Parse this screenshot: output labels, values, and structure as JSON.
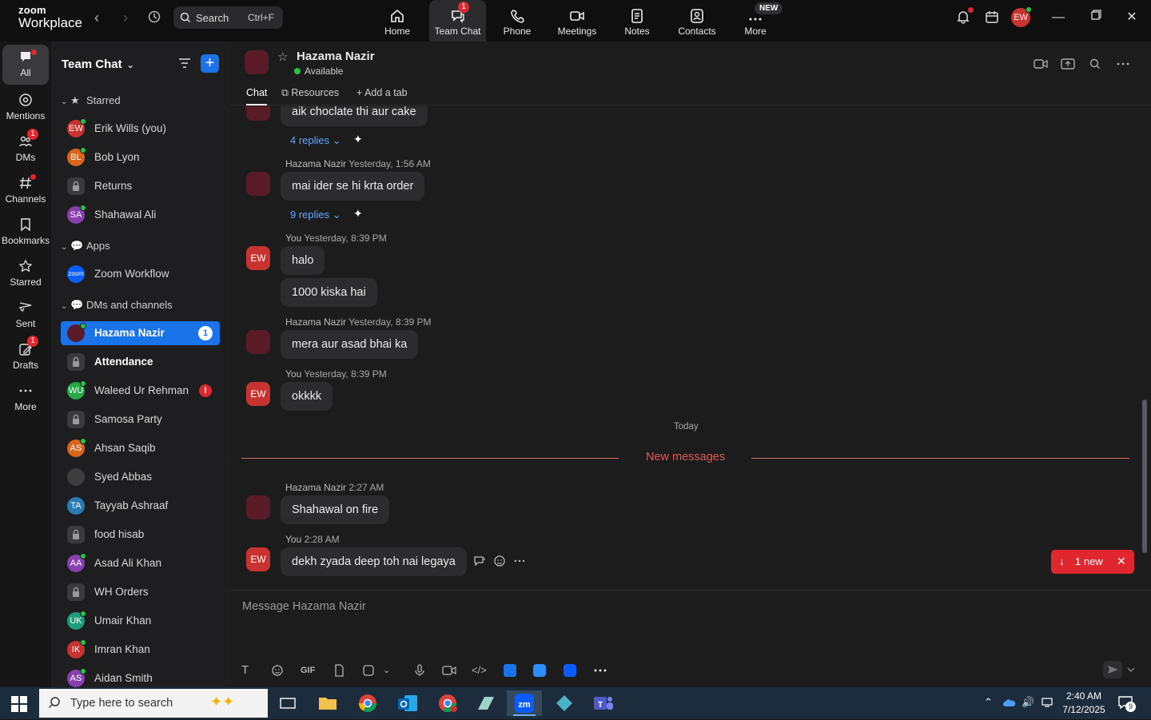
{
  "topbar": {
    "logo_line1": "zoom",
    "logo_line2": "Workplace",
    "search_label": "Search",
    "search_shortcut": "Ctrl+F",
    "nav": [
      {
        "label": "Home"
      },
      {
        "label": "Team Chat",
        "badge": "1"
      },
      {
        "label": "Phone"
      },
      {
        "label": "Meetings"
      },
      {
        "label": "Notes"
      },
      {
        "label": "Contacts"
      },
      {
        "label": "More",
        "badge": "NEW"
      }
    ],
    "avatar_initials": "EW"
  },
  "rail": [
    {
      "label": "All"
    },
    {
      "label": "Mentions"
    },
    {
      "label": "DMs",
      "badge": "1"
    },
    {
      "label": "Channels"
    },
    {
      "label": "Bookmarks"
    },
    {
      "label": "Starred"
    },
    {
      "label": "Sent"
    },
    {
      "label": "Drafts",
      "badge": "1"
    },
    {
      "label": "More"
    }
  ],
  "sidebar": {
    "title": "Team Chat",
    "sections": {
      "starred": "Starred",
      "apps": "Apps",
      "dms": "DMs and channels"
    },
    "starred_items": [
      {
        "name": "Erik Wills (you)",
        "initials": "EW",
        "color": "#c8322f"
      },
      {
        "name": "Bob Lyon",
        "initials": "BL",
        "color": "#d9641c"
      },
      {
        "name": "Returns",
        "initials": "",
        "color": "#3a3a3d"
      },
      {
        "name": "Shahawal Ali",
        "initials": "SA",
        "color": "#8a3fb0"
      }
    ],
    "apps_items": [
      {
        "name": "Zoom Workflow",
        "initials": "zoom",
        "color": "#0b5cff"
      }
    ],
    "dm_items": [
      {
        "name": "Hazama Nazir",
        "count": "1"
      },
      {
        "name": "Attendance"
      },
      {
        "name": "Waleed Ur Rehman",
        "initials": "WU",
        "color": "#28a745",
        "alert": "!"
      },
      {
        "name": "Samosa Party"
      },
      {
        "name": "Ahsan Saqib",
        "initials": "AS",
        "color": "#d9641c"
      },
      {
        "name": "Syed Abbas"
      },
      {
        "name": "Tayyab Ashraaf",
        "initials": "TA",
        "color": "#2a7ab8"
      },
      {
        "name": "food hisab"
      },
      {
        "name": "Asad Ali Khan",
        "initials": "AA",
        "color": "#8a3fb0"
      },
      {
        "name": "WH Orders"
      },
      {
        "name": "Umair Khan",
        "initials": "UK",
        "color": "#1f9d7a"
      },
      {
        "name": "Imran Khan",
        "initials": "IK",
        "color": "#c8322f"
      },
      {
        "name": "Aidan Smith",
        "initials": "AS",
        "color": "#8a3fb0"
      }
    ]
  },
  "chat": {
    "contact_name": "Hazama Nazir",
    "status": "Available",
    "tabs": [
      "Chat",
      "Resources",
      "Add a tab"
    ],
    "messages": [
      {
        "text": "aik choclate thi aur cake",
        "replies": "4 replies"
      },
      {
        "sender": "Hazama Nazir",
        "time": "Yesterday, 1:56 AM",
        "text": "mai ider se hi krta order",
        "replies": "9 replies"
      },
      {
        "sender": "You",
        "time": "Yesterday, 8:39 PM",
        "text": "halo",
        "text2": "1000 kiska hai",
        "avatar": "EW"
      },
      {
        "sender": "Hazama Nazir",
        "time": "Yesterday, 8:39 PM",
        "text": "mera aur asad bhai ka"
      },
      {
        "sender": "You",
        "time": "Yesterday, 8:39 PM",
        "text": "okkkk",
        "avatar": "EW"
      },
      {
        "sender": "Hazama Nazir",
        "time": "2:27 AM",
        "text": "Shahawal on fire"
      },
      {
        "sender": "You",
        "time": "2:28 AM",
        "text": "dekh zyada deep toh nai legaya",
        "avatar": "EW"
      }
    ],
    "day_divider": "Today",
    "new_messages_label": "New messages",
    "new_pill": "1 new",
    "composer_placeholder": "Message Hazama Nazir",
    "gif_label": "GIF"
  },
  "taskbar": {
    "search_placeholder": "Type here to search",
    "time": "2:40 AM",
    "date": "7/12/2025",
    "notif_count": "9"
  }
}
